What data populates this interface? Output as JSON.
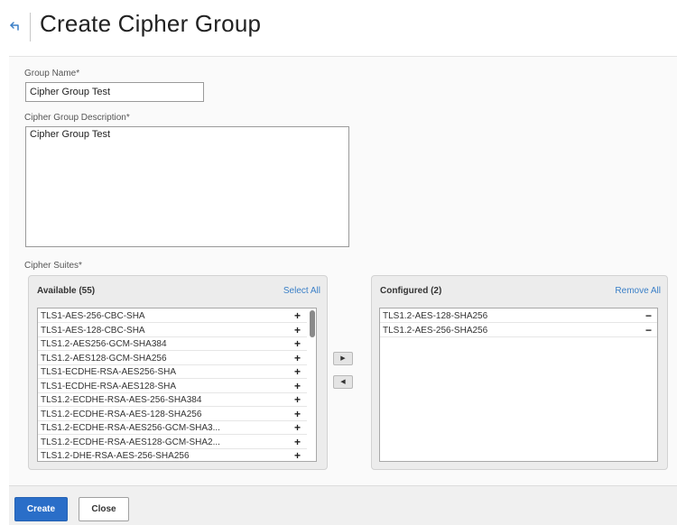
{
  "header": {
    "back_icon": "back-arrow-icon",
    "title": "Create Cipher Group"
  },
  "form": {
    "group_name": {
      "label": "Group Name*",
      "value": "Cipher Group Test"
    },
    "description": {
      "label": "Cipher Group Description*",
      "value": "Cipher Group Test"
    },
    "cipher_suites_label": "Cipher Suites*"
  },
  "available": {
    "title": "Available (55)",
    "select_all": "Select All",
    "add_symbol": "+",
    "items": [
      "TLS1-AES-256-CBC-SHA",
      "TLS1-AES-128-CBC-SHA",
      "TLS1.2-AES256-GCM-SHA384",
      "TLS1.2-AES128-GCM-SHA256",
      "TLS1-ECDHE-RSA-AES256-SHA",
      "TLS1-ECDHE-RSA-AES128-SHA",
      "TLS1.2-ECDHE-RSA-AES-256-SHA384",
      "TLS1.2-ECDHE-RSA-AES-128-SHA256",
      "TLS1.2-ECDHE-RSA-AES256-GCM-SHA3...",
      "TLS1.2-ECDHE-RSA-AES128-GCM-SHA2...",
      "TLS1.2-DHE-RSA-AES-256-SHA256"
    ]
  },
  "transfer": {
    "move_right_symbol": "▶",
    "move_left_symbol": "◀"
  },
  "configured": {
    "title": "Configured (2)",
    "remove_all": "Remove All",
    "remove_symbol": "−",
    "items": [
      "TLS1.2-AES-128-SHA256",
      "TLS1.2-AES-256-SHA256"
    ]
  },
  "footer": {
    "create_label": "Create",
    "close_label": "Close"
  },
  "colors": {
    "primary": "#2a6ec8",
    "link": "#3a7fc7"
  }
}
